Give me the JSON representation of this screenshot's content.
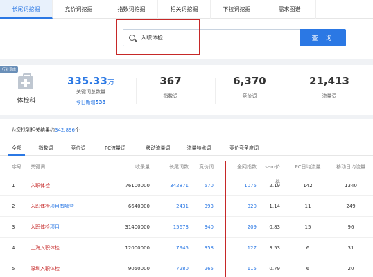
{
  "tabs": [
    "长尾词挖掘",
    "竞价词挖掘",
    "指数词挖掘",
    "相关词挖掘",
    "下拉词挖掘",
    "需求图谱"
  ],
  "search": {
    "value": "入职体检",
    "button": "查 询"
  },
  "stats": {
    "industry_tag": "行业词库",
    "category": "体检科",
    "total_keywords": "335.33",
    "total_unit": "万",
    "total_label": "关键词总数量",
    "new_today_label": "今日新增",
    "new_today_value": "538",
    "index_words": "367",
    "index_words_label": "指数词",
    "bid_words": "6,370",
    "bid_words_label": "竞价词",
    "traffic_words": "21,413",
    "traffic_words_label": "流量词"
  },
  "results": {
    "found_prefix": "为您找到相关结果约",
    "found_count": "342,896",
    "found_suffix": "个",
    "subtabs": [
      "全部",
      "指数词",
      "竞价词",
      "PC流量词",
      "移动流量词",
      "流量特点词",
      "竞价竞争度词"
    ],
    "columns": [
      "序号",
      "关键词",
      "收录量",
      "长尾词数",
      "竞价词",
      "全网指数",
      "sem价格",
      "PC日均流量",
      "移动日均流量"
    ],
    "rows": [
      {
        "idx": "1",
        "kw_red": "入职体检",
        "kw_blue": "",
        "search": "76100000",
        "long": "342871",
        "bid": "570",
        "total": "1075",
        "sem": "2.19",
        "pc": "142",
        "mob": "1340"
      },
      {
        "idx": "2",
        "kw_red": "入职体检",
        "kw_blue": "项目有哪些",
        "search": "6640000",
        "long": "2431",
        "bid": "393",
        "total": "320",
        "sem": "1.14",
        "pc": "11",
        "mob": "249"
      },
      {
        "idx": "3",
        "kw_red": "入职体检",
        "kw_blue": "项目",
        "search": "31400000",
        "long": "15673",
        "bid": "340",
        "total": "209",
        "sem": "0.83",
        "pc": "15",
        "mob": "96"
      },
      {
        "idx": "4",
        "kw_red": "上海入职体检",
        "kw_blue": "",
        "search": "12000000",
        "long": "7945",
        "bid": "358",
        "total": "127",
        "sem": "3.53",
        "pc": "6",
        "mob": "31"
      },
      {
        "idx": "5",
        "kw_red": "深圳入职体检",
        "kw_blue": "",
        "search": "9050000",
        "long": "7280",
        "bid": "265",
        "total": "115",
        "sem": "0.79",
        "pc": "6",
        "mob": "20"
      }
    ]
  },
  "colors": {
    "accent": "#2b78e4",
    "highlight": "#c62828"
  }
}
